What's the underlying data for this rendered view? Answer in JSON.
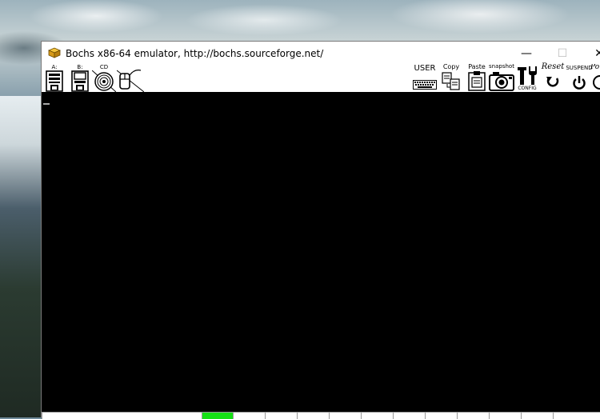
{
  "window": {
    "title": "Bochs x86-64 emulator, http://bochs.sourceforge.net/",
    "controls": {
      "minimize": "—",
      "maximize": "☐",
      "close": "✕"
    }
  },
  "toolbar": {
    "floppy_a": "A:",
    "floppy_b": "B:",
    "cdrom": "CD",
    "user": "USER",
    "copy": "Copy",
    "paste": "Paste",
    "snapshot": "snapshot",
    "config": "CONFIG",
    "reset": "Reset",
    "suspend": "SUSPEND",
    "power": "Po"
  },
  "statusbar": {
    "segments": [
      {
        "label": "",
        "active": false
      },
      {
        "label": "",
        "active": true
      },
      {
        "label": "",
        "active": false
      },
      {
        "label": "",
        "active": false
      },
      {
        "label": "",
        "active": false
      },
      {
        "label": "",
        "active": false
      },
      {
        "label": "",
        "active": false
      },
      {
        "label": "",
        "active": false
      },
      {
        "label": "",
        "active": false
      },
      {
        "label": "",
        "active": false
      },
      {
        "label": "",
        "active": false
      },
      {
        "label": "",
        "active": false
      },
      {
        "label": "",
        "active": false
      }
    ]
  },
  "colors": {
    "screen": "#000000",
    "status_active": "#15e015"
  }
}
